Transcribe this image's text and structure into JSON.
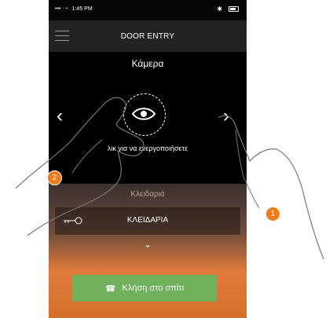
{
  "statusbar": {
    "time": "1:45 PM"
  },
  "header": {
    "title": "DOOR ENTRY"
  },
  "camera": {
    "title": "Κάμερα",
    "hint": "λικ για να ενεργοποιήσετε"
  },
  "lock": {
    "section_title": "Κλειδαριά",
    "button_label": "ΚΛΕΙΔΑΡΙΑ"
  },
  "call": {
    "label": "Κλήση στο σπίτι"
  },
  "annotations": {
    "left": "2",
    "right": "1"
  },
  "colors": {
    "accent_green": "#6fb15c",
    "callout_orange": "#ee7b1d"
  }
}
